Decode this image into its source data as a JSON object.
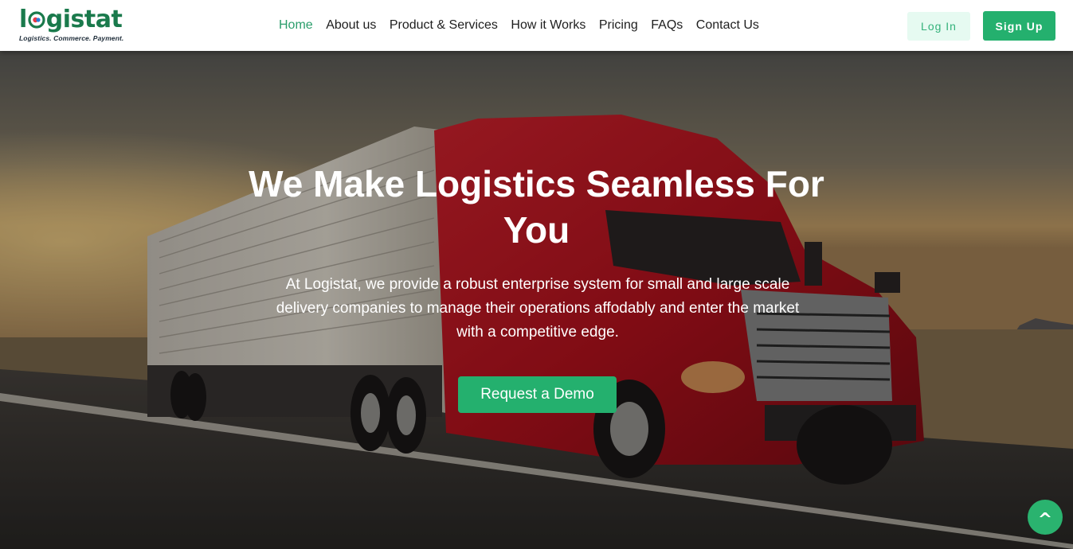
{
  "brand": {
    "logo_text_before": "l",
    "logo_text_after": "gistat",
    "tagline": "Logistics.  Commerce.  Payment.",
    "primary_color": "#24b06e",
    "logo_color": "#1a7a4c"
  },
  "nav": {
    "items": [
      {
        "label": "Home",
        "active": true
      },
      {
        "label": "About us",
        "active": false
      },
      {
        "label": "Product & Services",
        "active": false
      },
      {
        "label": "How it Works",
        "active": false
      },
      {
        "label": "Pricing",
        "active": false
      },
      {
        "label": "FAQs",
        "active": false
      },
      {
        "label": "Contact Us",
        "active": false
      }
    ]
  },
  "auth": {
    "login_label": "Log In",
    "signup_label": "Sign Up"
  },
  "hero": {
    "title": "We Make Logistics Seamless For You",
    "description": "At Logistat, we provide a robust enterprise system for small and large scale delivery companies to manage their operations affodably and enter the market with a competitive edge.",
    "cta_label": "Request a Demo",
    "background_subject": "red semi-truck on highway at sunset"
  },
  "scroll_top": {
    "icon": "caret-up-icon",
    "glyph": "^"
  }
}
